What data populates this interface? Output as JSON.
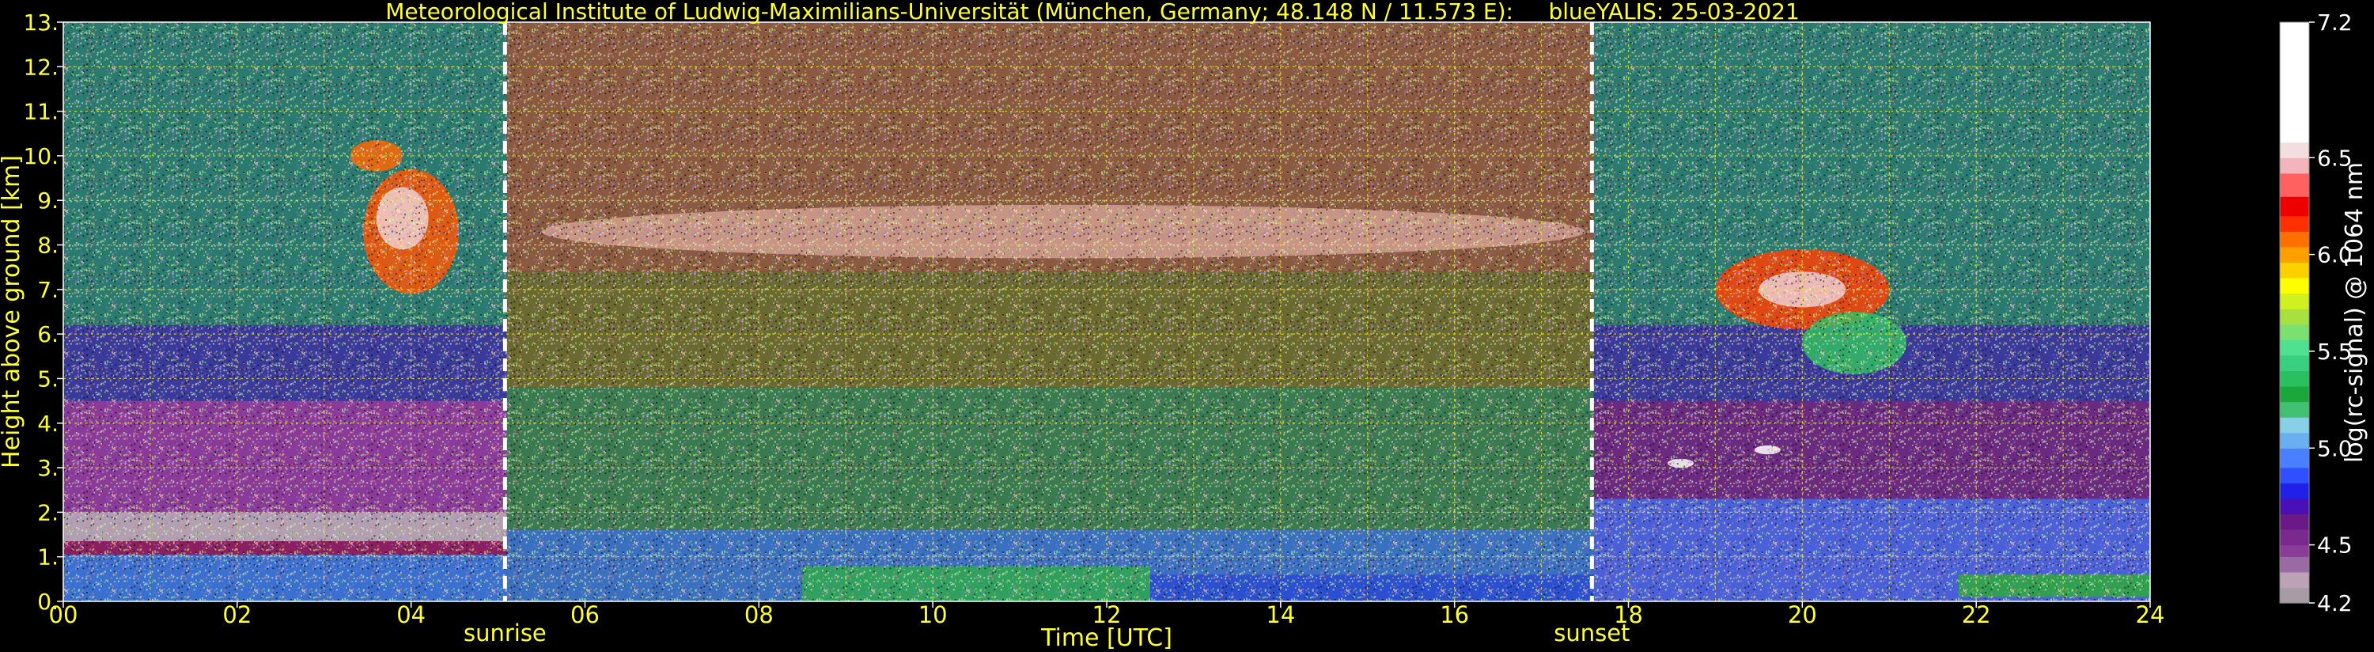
{
  "chart_data": {
    "type": "heatmap",
    "title": "Meteorological Institute of Ludwig-Maximilians-Universität (München, Germany; 48.148 N / 11.573 E):     blueYALIS: 25-03-2021",
    "xlabel": "Time [UTC]",
    "ylabel": "Height above ground [km]",
    "xlim": [
      0,
      24
    ],
    "ylim": [
      0,
      13
    ],
    "x_ticks": [
      "00",
      "02",
      "04",
      "06",
      "08",
      "10",
      "12",
      "14",
      "16",
      "18",
      "20",
      "22",
      "24"
    ],
    "x_tick_values": [
      0,
      2,
      4,
      6,
      8,
      10,
      12,
      14,
      16,
      18,
      20,
      22,
      24
    ],
    "y_ticks": [
      "0.",
      "1.",
      "2.",
      "3.",
      "4.",
      "5.",
      "6.",
      "7.",
      "8.",
      "9.",
      "10.",
      "11.",
      "12.",
      "13."
    ],
    "y_tick_values": [
      0,
      1,
      2,
      3,
      4,
      5,
      6,
      7,
      8,
      9,
      10,
      11,
      12,
      13
    ],
    "grid": true,
    "annotations": [
      {
        "label": "sunrise",
        "x": 5.08
      },
      {
        "label": "sunset",
        "x": 17.58
      }
    ],
    "colorbar": {
      "label": "log(rc-signal) @ 1064 nm",
      "range": [
        4.2,
        7.2
      ],
      "ticks": [
        "4.2",
        "4.5",
        "5.0",
        "5.5",
        "6.0",
        "6.5",
        "7.2"
      ],
      "tick_values": [
        4.2,
        4.5,
        5.0,
        5.5,
        6.0,
        6.5,
        7.2
      ],
      "colors": [
        "#a89ca4",
        "#bba3b5",
        "#9a6aa5",
        "#8a3d98",
        "#7a2a8e",
        "#6a1a86",
        "#4a10b8",
        "#2020e8",
        "#3050ff",
        "#4a80ff",
        "#6ab0f0",
        "#88d0e8",
        "#40c070",
        "#1aa83a",
        "#2ac060",
        "#38d080",
        "#50e090",
        "#7ae070",
        "#a8e040",
        "#d0f020",
        "#ffff00",
        "#ffd000",
        "#ffa000",
        "#ff7000",
        "#ff3000",
        "#ee0000",
        "#ff6060",
        "#f2b5bb",
        "#f2dede",
        "#ffffff"
      ],
      "color_bounds": [
        4.2,
        4.28,
        4.36,
        4.44,
        4.5,
        4.58,
        4.66,
        4.74,
        4.82,
        4.9,
        5.0,
        5.08,
        5.16,
        5.24,
        5.32,
        5.4,
        5.48,
        5.56,
        5.64,
        5.72,
        5.8,
        5.88,
        5.96,
        6.04,
        6.12,
        6.2,
        6.3,
        6.42,
        6.5,
        6.58,
        7.2
      ]
    },
    "background_layers": [
      {
        "x0": 0,
        "x1": 24,
        "h0": 1.05,
        "h1": 1.35,
        "color": "#8a2060"
      },
      {
        "x0": 0,
        "x1": 5.1,
        "h0": 0,
        "h1": 1.05,
        "color": "#3a70d0"
      },
      {
        "x0": 5.1,
        "x1": 17.6,
        "h0": 0,
        "h1": 1.6,
        "color": "#3a70c0"
      },
      {
        "x0": 8.5,
        "x1": 12.5,
        "h0": 0,
        "h1": 0.8,
        "color": "#30a060"
      },
      {
        "x0": 12.5,
        "x1": 17.6,
        "h0": 0,
        "h1": 0.6,
        "color": "#2a50d0"
      },
      {
        "x0": 17.6,
        "x1": 24,
        "h0": 0,
        "h1": 2.3,
        "color": "#4a60d8"
      },
      {
        "x0": 21.8,
        "x1": 24,
        "h0": 0.1,
        "h1": 0.6,
        "color": "#30a050"
      },
      {
        "x0": 0,
        "x1": 5.1,
        "h0": 1.35,
        "h1": 2.0,
        "color": "#b0a0b0"
      },
      {
        "x0": 0,
        "x1": 5.1,
        "h0": 2.0,
        "h1": 4.5,
        "color": "#8a3a98"
      },
      {
        "x0": 0,
        "x1": 5.1,
        "h0": 4.5,
        "h1": 6.2,
        "color": "#3a3a9a"
      },
      {
        "x0": 0,
        "x1": 5.1,
        "h0": 6.2,
        "h1": 13,
        "color": "#2a7a70"
      },
      {
        "x0": 5.1,
        "x1": 17.6,
        "h0": 1.6,
        "h1": 4.8,
        "color": "#3a7a50"
      },
      {
        "x0": 5.1,
        "x1": 17.6,
        "h0": 4.8,
        "h1": 7.4,
        "color": "#6a6a30"
      },
      {
        "x0": 5.1,
        "x1": 17.6,
        "h0": 7.4,
        "h1": 13,
        "color": "#8a5a40"
      },
      {
        "x0": 17.6,
        "x1": 24,
        "h0": 2.3,
        "h1": 4.5,
        "color": "#6a2a80"
      },
      {
        "x0": 17.6,
        "x1": 24,
        "h0": 4.5,
        "h1": 6.2,
        "color": "#3a3a9a"
      },
      {
        "x0": 17.6,
        "x1": 24,
        "h0": 6.2,
        "h1": 13,
        "color": "#2a7a70"
      }
    ],
    "cloud_features": [
      {
        "x": 4.0,
        "h": 8.3,
        "rx": 0.55,
        "ry": 1.4,
        "color": "#ff5500"
      },
      {
        "x": 3.9,
        "h": 8.6,
        "rx": 0.3,
        "ry": 0.7,
        "color": "#f0d0d0"
      },
      {
        "x": 3.6,
        "h": 10.0,
        "rx": 0.3,
        "ry": 0.35,
        "color": "#ff6600"
      },
      {
        "x": 11.5,
        "h": 8.3,
        "rx": 6.0,
        "ry": 0.6,
        "color": "#d0a090"
      },
      {
        "x": 20.0,
        "h": 7.0,
        "rx": 1.0,
        "ry": 0.9,
        "color": "#ff4000"
      },
      {
        "x": 20.0,
        "h": 7.0,
        "rx": 0.5,
        "ry": 0.4,
        "color": "#f0d0d0"
      },
      {
        "x": 20.6,
        "h": 5.8,
        "rx": 0.6,
        "ry": 0.7,
        "color": "#30c060"
      },
      {
        "x": 18.6,
        "h": 3.1,
        "rx": 0.15,
        "ry": 0.1,
        "color": "#ffffff"
      },
      {
        "x": 19.6,
        "h": 3.4,
        "rx": 0.15,
        "ry": 0.1,
        "color": "#ffffff"
      }
    ]
  }
}
